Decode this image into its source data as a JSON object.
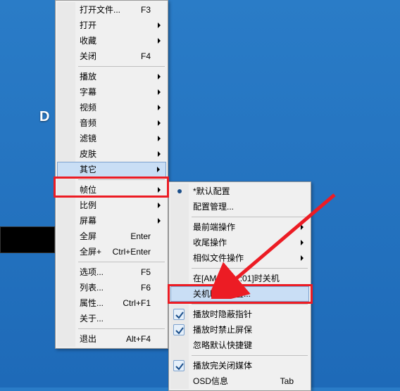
{
  "bg_logo_letter": "D",
  "menu1": {
    "open_file": "打开文件...",
    "open_file_key": "F3",
    "open": "打开",
    "favorites": "收藏",
    "close": "关闭",
    "close_key": "F4",
    "play": "播放",
    "subtitle": "字幕",
    "video": "视频",
    "audio": "音频",
    "filter": "滤镜",
    "skin": "皮肤",
    "other": "其它",
    "fps": "帧位",
    "ratio": "比例",
    "screen": "屏幕",
    "fullscreen": "全屏",
    "fullscreen_key": "Enter",
    "fullscreen_plus": "全屏+",
    "fullscreen_plus_key": "Ctrl+Enter",
    "options": "选项...",
    "options_key": "F5",
    "list": "列表...",
    "list_key": "F6",
    "properties": "属性...",
    "properties_key": "Ctrl+F1",
    "about": "关于...",
    "exit": "退出",
    "exit_key": "Alt+F4"
  },
  "menu2": {
    "default_config": "*默认配置",
    "config_manage": "配置管理...",
    "front_op": "最前端操作",
    "tail_op": "收尾操作",
    "similar_file": "相似文件操作",
    "shutdown_at": "在[AM 04:01:01]时关机",
    "shutdown_setting": "关机时间设置...",
    "hide_pointer": "播放时隐蔽指针",
    "no_screensaver": "播放时禁止屏保",
    "ignore_shortcut": "忽略默认快捷键",
    "close_media": "播放完关闭媒体",
    "osd_info": "OSD信息",
    "osd_key": "Tab"
  }
}
